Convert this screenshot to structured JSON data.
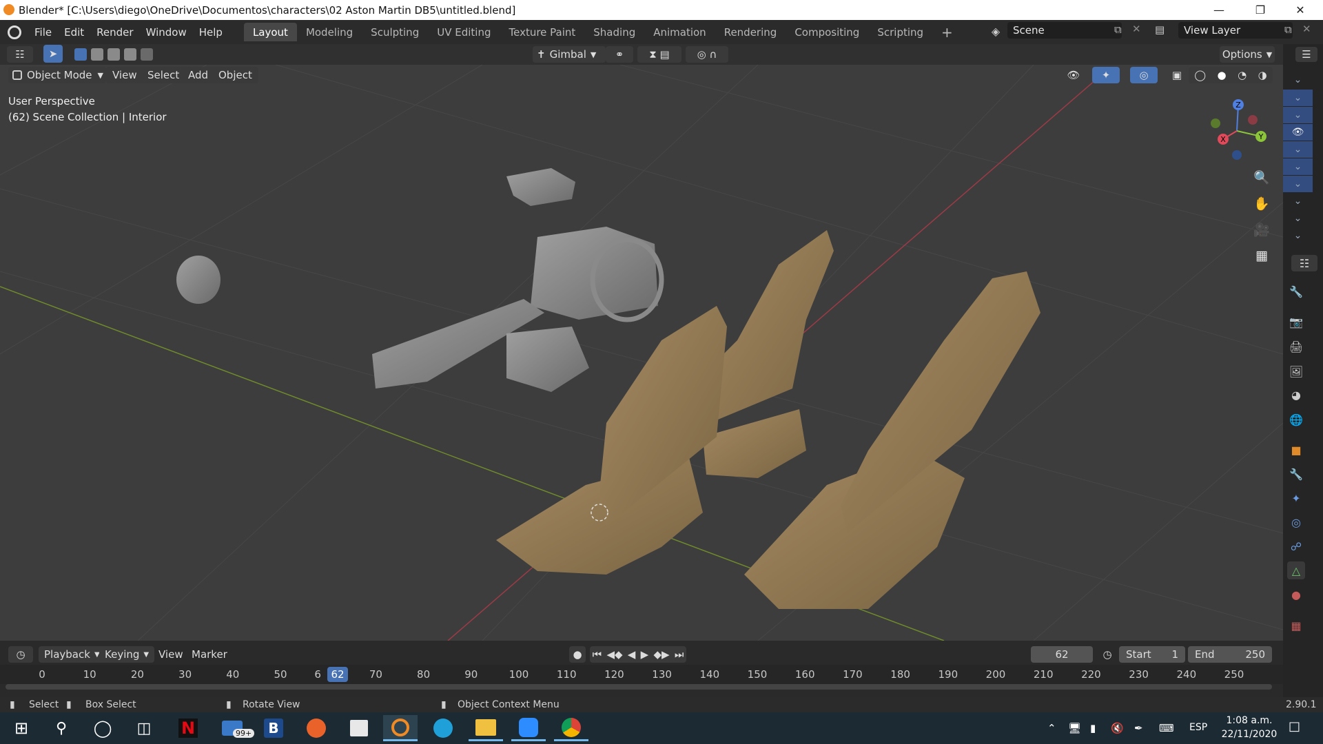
{
  "window": {
    "title": "Blender* [C:\\Users\\diego\\OneDrive\\Documentos\\characters\\02 Aston Martin DB5\\untitled.blend]"
  },
  "menu": [
    "File",
    "Edit",
    "Render",
    "Window",
    "Help"
  ],
  "workspaces": [
    "Layout",
    "Modeling",
    "Sculpting",
    "UV Editing",
    "Texture Paint",
    "Shading",
    "Animation",
    "Rendering",
    "Compositing",
    "Scripting"
  ],
  "active_workspace": "Layout",
  "scene": {
    "name": "Scene",
    "view_layer": "View Layer"
  },
  "tool_header": {
    "orientation": "Gimbal",
    "options": "Options"
  },
  "view_header": {
    "mode": "Object Mode",
    "items": [
      "View",
      "Select",
      "Add",
      "Object"
    ]
  },
  "viewport": {
    "perspective": "User Perspective",
    "collection_info": "(62) Scene Collection | Interior"
  },
  "gizmo": {
    "z": "Z",
    "y": "Y",
    "x": "X"
  },
  "timeline": {
    "menus": [
      "Playback",
      "Keying",
      "View",
      "Marker"
    ],
    "current_frame": "62",
    "start_label": "Start",
    "start": "1",
    "end_label": "End",
    "end": "250",
    "ticks": [
      "0",
      "10",
      "20",
      "30",
      "40",
      "50",
      "6",
      "70",
      "80",
      "90",
      "100",
      "110",
      "120",
      "130",
      "140",
      "150",
      "160",
      "170",
      "180",
      "190",
      "200",
      "210",
      "220",
      "230",
      "240",
      "250"
    ],
    "playhead": "62"
  },
  "status": {
    "select": "Select",
    "box_select": "Box Select",
    "rotate": "Rotate View",
    "context": "Object Context Menu",
    "version": "2.90.1"
  },
  "taskbar": {
    "badge": "99+",
    "lang": "ESP",
    "time": "1:08 a.m.",
    "date": "22/11/2020"
  }
}
